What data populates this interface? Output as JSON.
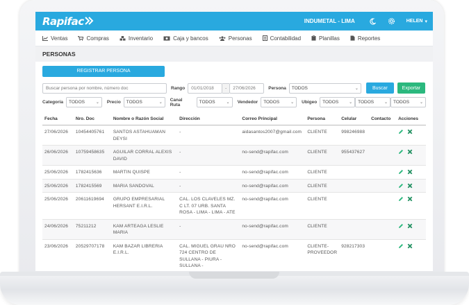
{
  "app": {
    "logo": "Rapifac",
    "company": "INDUMETAL - LIMA",
    "user": "HELEN",
    "icons": [
      "moon-icon",
      "gear-icon",
      "chevron-down-icon"
    ]
  },
  "menu": [
    {
      "label": "Ventas",
      "icon": "chart-icon"
    },
    {
      "label": "Compras",
      "icon": "cart-icon"
    },
    {
      "label": "Inventario",
      "icon": "boxes-icon"
    },
    {
      "label": "Caja y bancos",
      "icon": "cash-icon"
    },
    {
      "label": "Personas",
      "icon": "users-icon"
    },
    {
      "label": "Contabilidad",
      "icon": "ledger-icon"
    },
    {
      "label": "Planillas",
      "icon": "clipboard-icon"
    },
    {
      "label": "Reportes",
      "icon": "report-icon"
    }
  ],
  "page": {
    "title": "PERSONAS",
    "register_button": "REGISTRAR PERSONA"
  },
  "filters": {
    "search_placeholder": "Buscar persona por nombre, número doc",
    "rango_label": "Rango",
    "date_from": "01/01/2018",
    "date_sep": "-",
    "date_to": "27/06/2026",
    "persona_label": "Persona",
    "persona_value": "TODOS",
    "buscar_button": "Buscar",
    "exportar_button": "Exportar",
    "categoria_label": "Categoría",
    "categoria_value": "TODOS",
    "precio_label": "Precio",
    "precio_value": "TODOS",
    "canal_label": "Canal Ruta",
    "canal_value": "TODOS",
    "vendedor_label": "Vendedor",
    "vendedor_value": "TODOS",
    "ubigeo_label": "Ubigeo",
    "ubigeo_values": [
      "TODOS",
      "TODOS",
      "TODOS"
    ]
  },
  "table": {
    "headers": [
      "Fecha",
      "Nro. Doc",
      "Nombre o Razón Social",
      "Dirección",
      "Correo Principal",
      "Persona",
      "Celular",
      "Contacto",
      "Acciones"
    ],
    "rows": [
      {
        "fecha": "27/06/2026",
        "doc": "10454405761",
        "nombre": "SANTOS ASTAHUAMAN DEYSI",
        "direccion": "-",
        "correo": "aidasantos2007@gmail.com",
        "persona": "CLIENTE",
        "celular": "998246988",
        "contacto": ""
      },
      {
        "fecha": "26/06/2026",
        "doc": "10759458635",
        "nombre": "AGUILAR CORRAL ALEXIS DAVID",
        "direccion": "-",
        "correo": "no-send@rapifac.com",
        "persona": "CLIENTE",
        "celular": "955437627",
        "contacto": ""
      },
      {
        "fecha": "25/06/2026",
        "doc": "1782415636",
        "nombre": "MARTIN QUISPE",
        "direccion": "-",
        "correo": "no-send@rapifac.com",
        "persona": "CLIENTE",
        "celular": "",
        "contacto": ""
      },
      {
        "fecha": "25/06/2026",
        "doc": "1782415569",
        "nombre": "MARIA SANDOVAL",
        "direccion": "-",
        "correo": "no-send@rapifac.com",
        "persona": "CLIENTE",
        "celular": "",
        "contacto": ""
      },
      {
        "fecha": "25/06/2026",
        "doc": "20611619694",
        "nombre": "GRUPO EMPRESARIAL HERSANT E.I.R.L.",
        "direccion": "CAL. LOS CLAVELES MZ. C LT. 07 URB. SANTA ROSA - LIMA - LIMA - ATE",
        "correo": "no-send@rapifac.com",
        "persona": "CLIENTE",
        "celular": "",
        "contacto": ""
      },
      {
        "fecha": "24/06/2026",
        "doc": "75211212",
        "nombre": "KAM ARTEAGA LESLIE MARIA",
        "direccion": "-",
        "correo": "no-send@rapifac.com",
        "persona": "CLIENTE",
        "celular": "",
        "contacto": ""
      },
      {
        "fecha": "23/06/2026",
        "doc": "20529707178",
        "nombre": "KAM BAZAR LIBRERIA E.I.R.L.",
        "direccion": "CAL. MIGUEL GRAU NRO 724 CENTRO DE SULLANA - PIURA - SULLANA -",
        "correo": "no-send@rapifac.com",
        "persona": "CLIENTE-PROVEEDOR",
        "celular": "928217303",
        "contacto": ""
      }
    ]
  },
  "colors": {
    "primary": "#29a9df",
    "success": "#2bb87e",
    "edit": "#2bb87e",
    "delete": "#1f8f5f"
  }
}
